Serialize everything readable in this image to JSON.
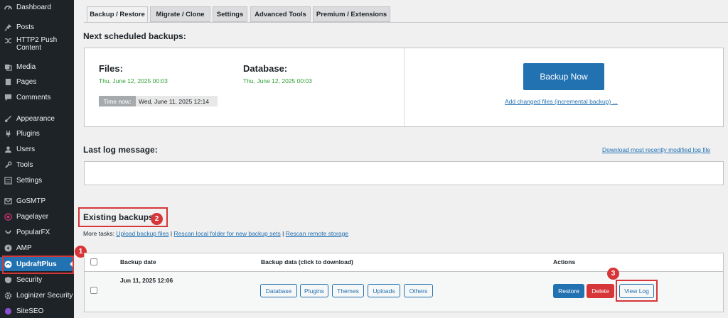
{
  "sidebar": {
    "items": [
      {
        "label": "Dashboard",
        "icon": "dashboard-icon"
      },
      {
        "label": "Posts",
        "icon": "pin-icon"
      },
      {
        "label": "HTTP2 Push Content",
        "icon": "shuffle-icon"
      },
      {
        "label": "Media",
        "icon": "media-icon"
      },
      {
        "label": "Pages",
        "icon": "pages-icon"
      },
      {
        "label": "Comments",
        "icon": "comment-icon"
      },
      {
        "label": "Appearance",
        "icon": "brush-icon"
      },
      {
        "label": "Plugins",
        "icon": "plug-icon"
      },
      {
        "label": "Users",
        "icon": "user-icon"
      },
      {
        "label": "Tools",
        "icon": "wrench-icon"
      },
      {
        "label": "Settings",
        "icon": "settings-icon"
      },
      {
        "label": "GoSMTP",
        "icon": "mail-icon"
      },
      {
        "label": "Pagelayer",
        "icon": "pagelayer-icon"
      },
      {
        "label": "PopularFX",
        "icon": "popularfx-icon"
      },
      {
        "label": "AMP",
        "icon": "amp-icon"
      },
      {
        "label": "UpdraftPlus",
        "icon": "updraft-icon"
      },
      {
        "label": "Security",
        "icon": "shield-icon"
      },
      {
        "label": "Loginizer Security",
        "icon": "gear-icon"
      },
      {
        "label": "SiteSEO",
        "icon": "siteseo-icon"
      }
    ]
  },
  "tabs": [
    "Backup / Restore",
    "Migrate / Clone",
    "Settings",
    "Advanced Tools",
    "Premium / Extensions"
  ],
  "scheduled": {
    "heading": "Next scheduled backups:",
    "files_label": "Files:",
    "files_time": "Thu, June 12, 2025 00:03",
    "database_label": "Database:",
    "database_time": "Thu, June 12, 2025 00:03",
    "time_now_label": "Time now:",
    "time_now_value": "Wed, June 11, 2025 12:14",
    "backup_now": "Backup Now",
    "incremental_link": "Add changed files (incremental backup) ..."
  },
  "log": {
    "heading": "Last log message:",
    "download_link": "Download most recently modified log file"
  },
  "existing": {
    "heading": "Existing backups",
    "more_tasks_label": "More tasks:",
    "upload_link": "Upload backup files",
    "sep": "|",
    "rescan_local_link": "Rescan local folder for new backup sets",
    "rescan_remote_link": "Rescan remote storage",
    "table": {
      "headers": [
        "Backup date",
        "Backup data (click to download)",
        "Actions"
      ],
      "row": {
        "date": "Jun 11, 2025 12:06",
        "data_buttons": [
          "Database",
          "Plugins",
          "Themes",
          "Uploads",
          "Others"
        ],
        "restore": "Restore",
        "delete": "Delete",
        "view_log": "View Log"
      }
    }
  },
  "callouts": [
    "1",
    "2",
    "3"
  ],
  "colors": {
    "sidebar_bg": "#1d2327",
    "primary": "#2271b1",
    "danger": "#d63638",
    "success": "#2ea233"
  }
}
